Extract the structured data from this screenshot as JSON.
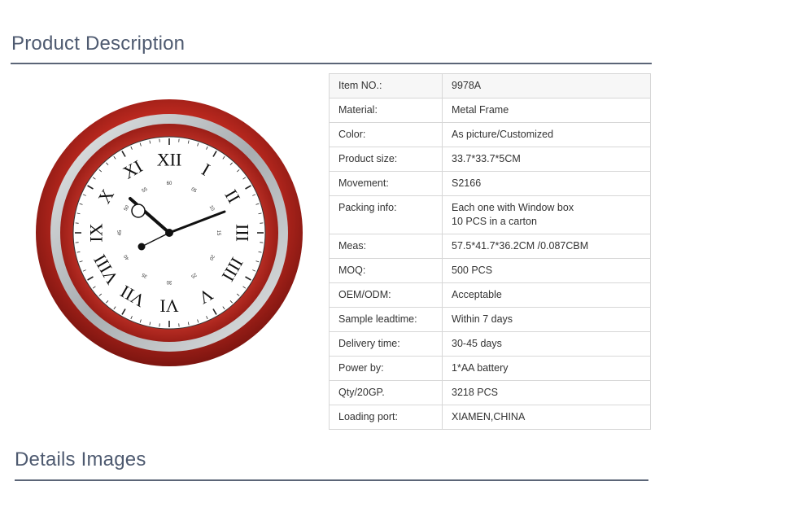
{
  "sections": {
    "description_title": "Product Description",
    "details_title": "Details Images"
  },
  "specs": [
    {
      "label": "Item NO.:",
      "value": [
        "9978A"
      ]
    },
    {
      "label": "Material:",
      "value": [
        "Metal Frame"
      ]
    },
    {
      "label": "Color:",
      "value": [
        "As picture/Customized"
      ]
    },
    {
      "label": "Product size:",
      "value": [
        "33.7*33.7*5CM"
      ]
    },
    {
      "label": "Movement:",
      "value": [
        "S2166"
      ]
    },
    {
      "label": "Packing info:",
      "value": [
        "Each one with Window box",
        "10 PCS in a carton"
      ]
    },
    {
      "label": "Meas:",
      "value": [
        "57.5*41.7*36.2CM /0.087CBM"
      ]
    },
    {
      "label": "MOQ:",
      "value": [
        "500 PCS"
      ]
    },
    {
      "label": "OEM/ODM:",
      "value": [
        "Acceptable"
      ]
    },
    {
      "label": "Sample leadtime:",
      "value": [
        "Within 7 days"
      ]
    },
    {
      "label": "Delivery time:",
      "value": [
        "30-45 days"
      ]
    },
    {
      "label": "Power by:",
      "value": [
        "1*AA battery"
      ]
    },
    {
      "label": "Qty/20GP.",
      "value": [
        "3218 PCS"
      ]
    },
    {
      "label": "Loading port:",
      "value": [
        "XIAMEN,CHINA"
      ]
    }
  ],
  "clock": {
    "numerals": [
      "XII",
      "I",
      "II",
      "III",
      "IIII",
      "V",
      "VI",
      "VII",
      "VIII",
      "IX",
      "X",
      "XI"
    ],
    "minute_marks": [
      "60",
      "05",
      "10",
      "15",
      "20",
      "25",
      "30",
      "35",
      "40",
      "45",
      "50",
      "55"
    ],
    "colors": {
      "frame": "#b8241c",
      "rim": "#c0c4c6",
      "dial": "#ffffff",
      "hands": "#111111"
    }
  }
}
